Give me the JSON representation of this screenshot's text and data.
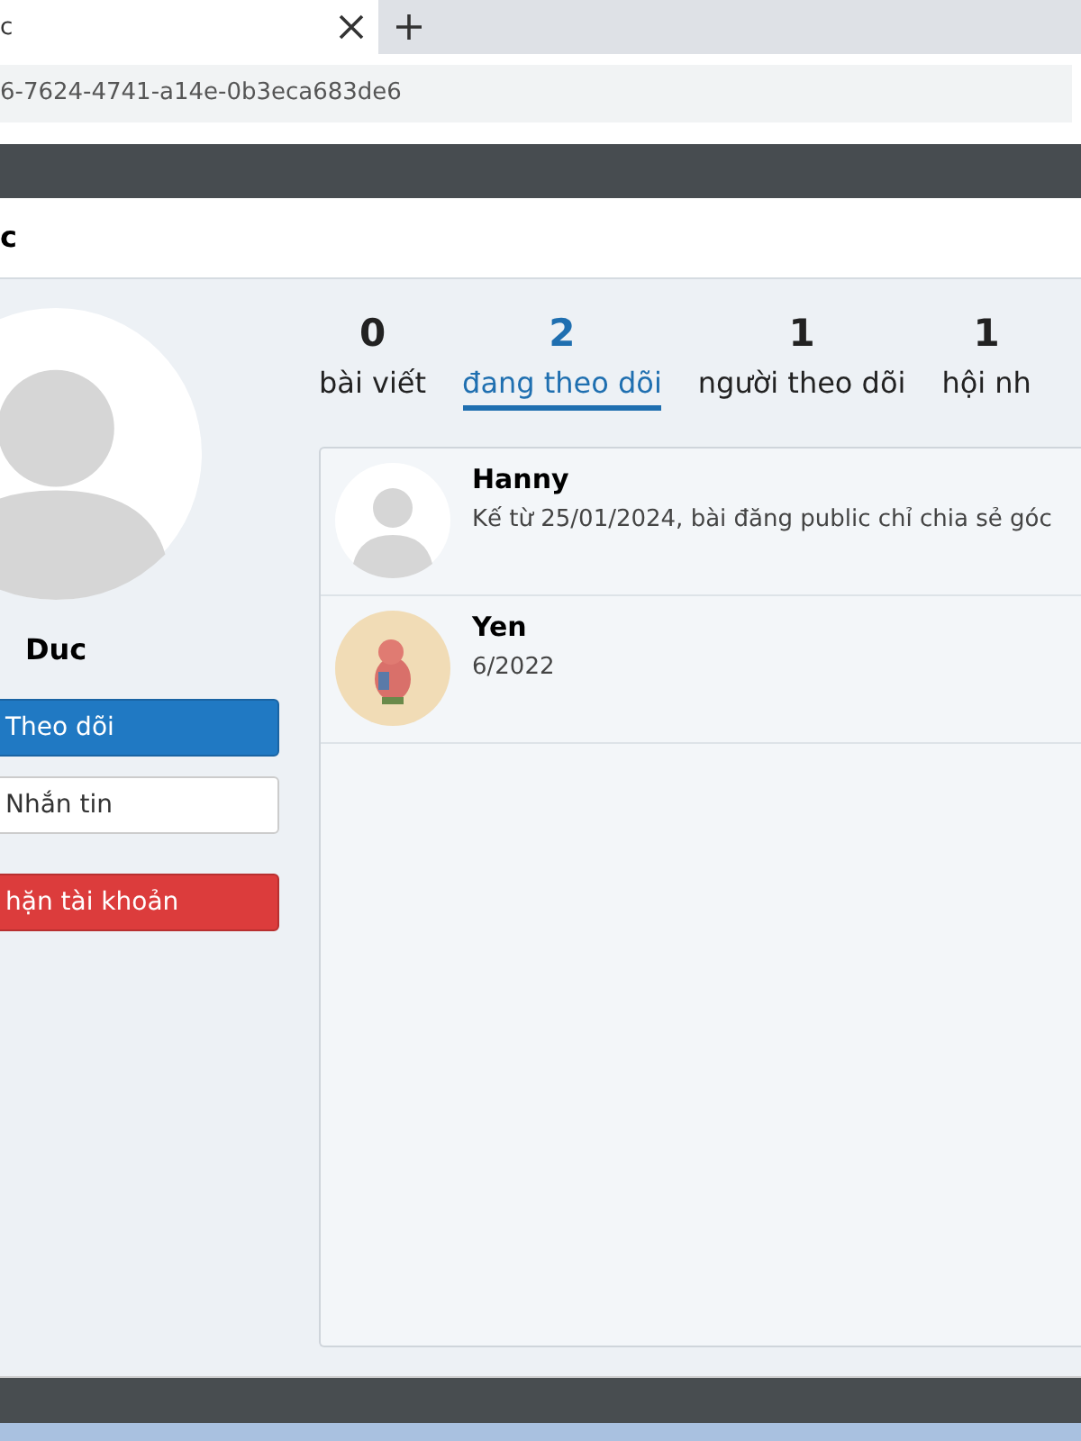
{
  "browser": {
    "tab_title": "c",
    "address": "6-7624-4741-a14e-0b3eca683de6"
  },
  "dialog": {
    "title": "c"
  },
  "profile": {
    "name": "Duc",
    "buttons": [
      {
        "kind": "primary",
        "label": "Theo dõi"
      },
      {
        "kind": "default",
        "label": "Nhắn tin"
      },
      {
        "kind": "danger",
        "label": "hặn tài khoản"
      }
    ]
  },
  "stats": [
    {
      "count": "0",
      "label": "bài viết",
      "selected": false
    },
    {
      "count": "2",
      "label": "đang theo dõi",
      "selected": true
    },
    {
      "count": "1",
      "label": "người theo dõi",
      "selected": false
    },
    {
      "count": "1",
      "label": "hội nh",
      "selected": false
    }
  ],
  "following": [
    {
      "name": "Hanny",
      "detail": "Kế từ 25/01/2024, bài đăng public chỉ chia sẻ góc",
      "kind": "silhouette"
    },
    {
      "name": "Yen",
      "detail": "6/2022",
      "kind": "cartoon"
    }
  ]
}
